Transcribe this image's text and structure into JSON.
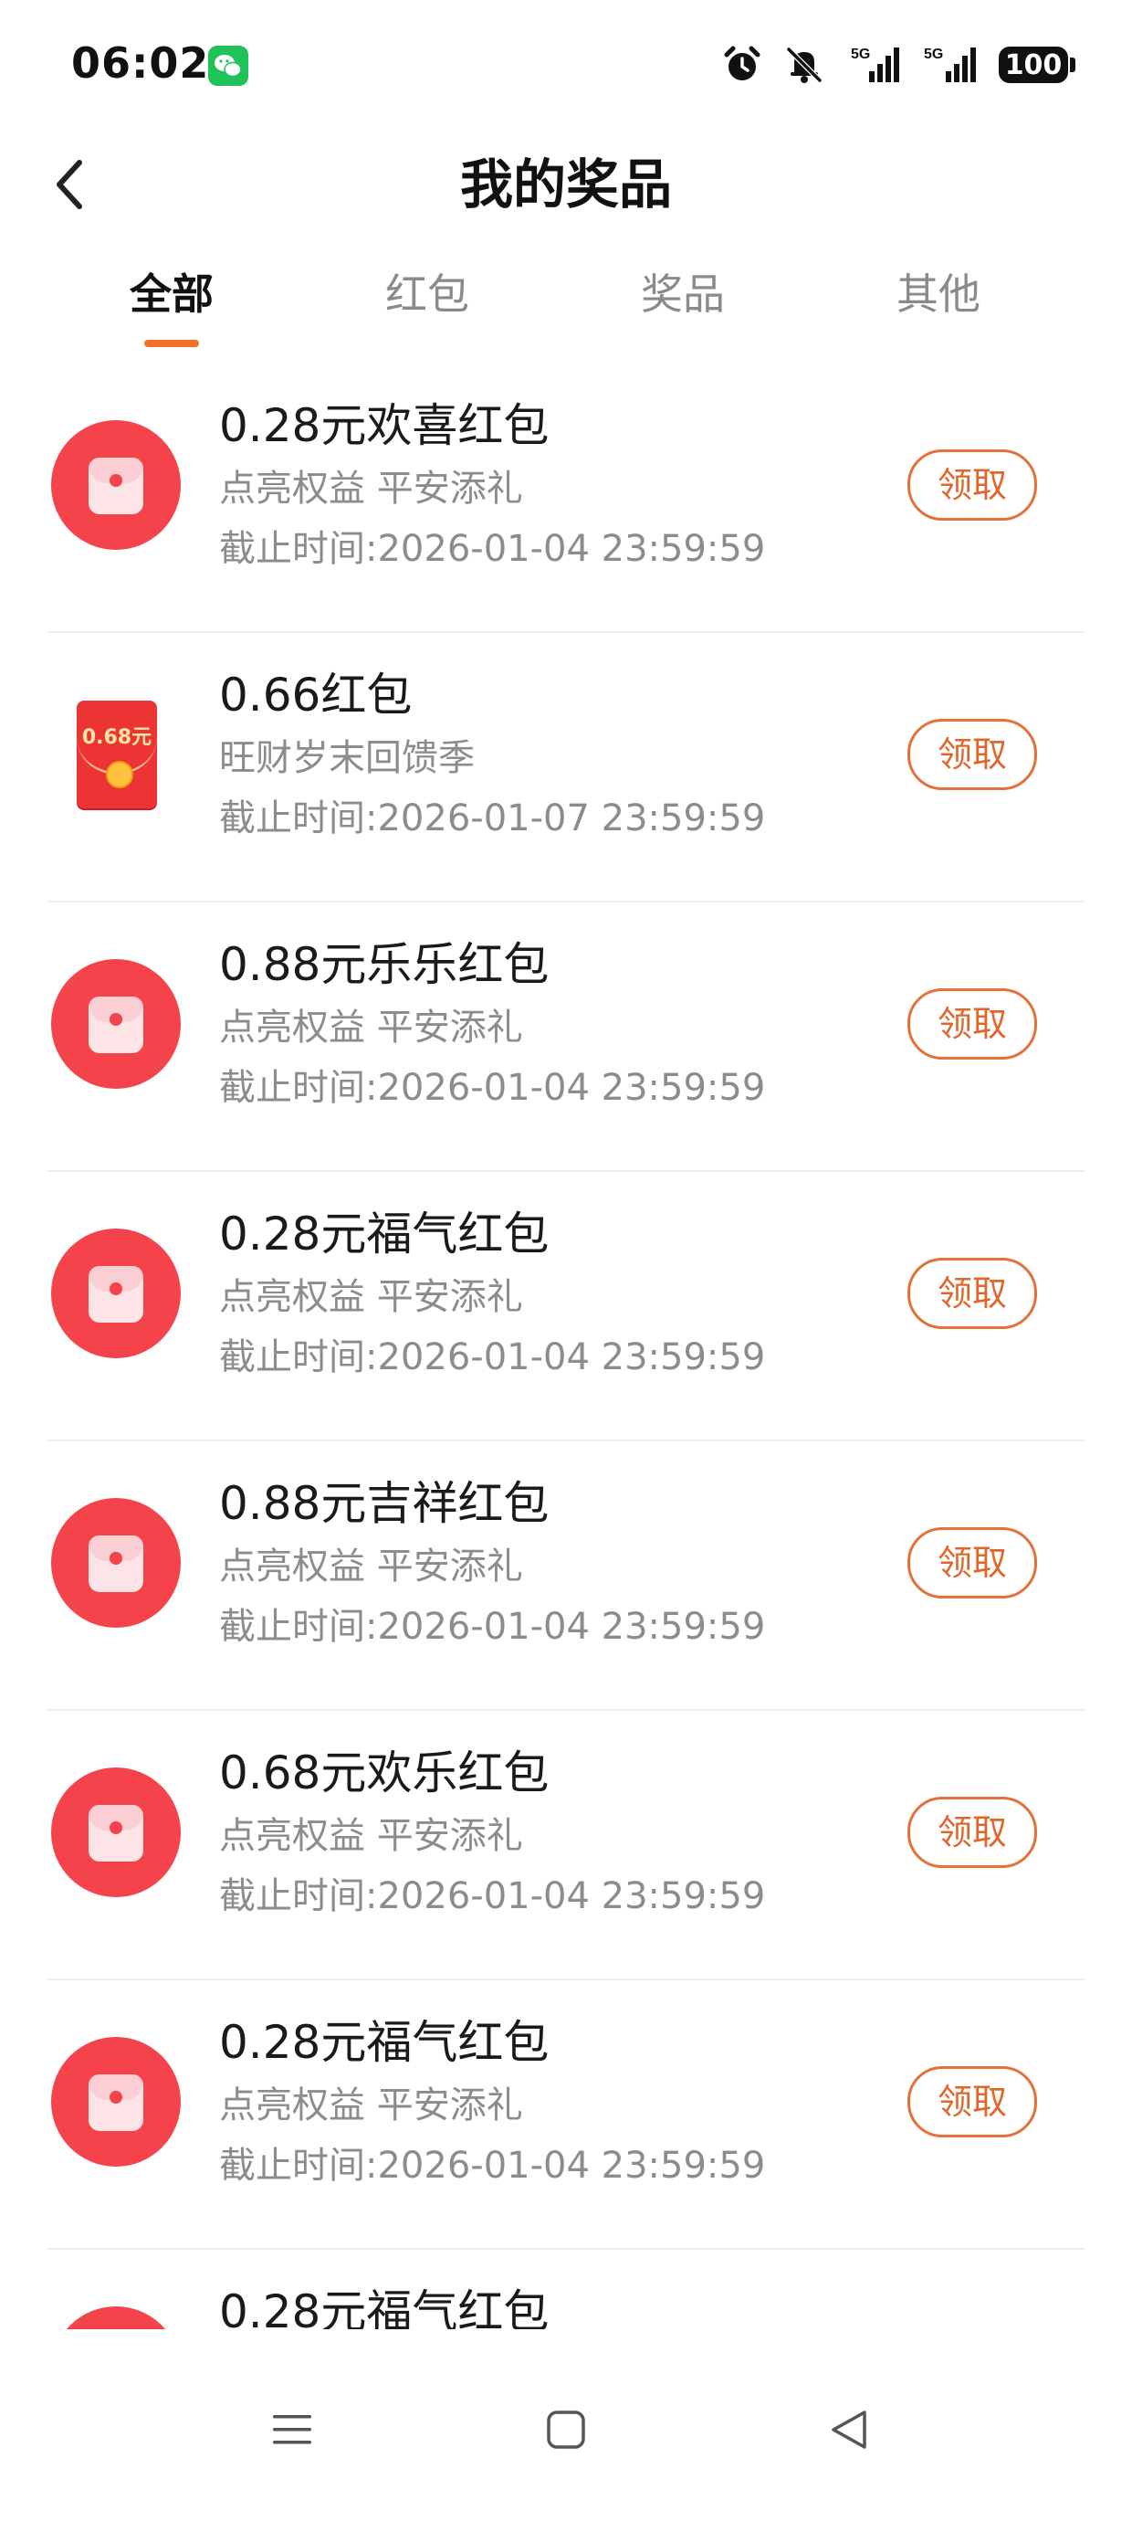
{
  "status_bar": {
    "time": "06:02",
    "battery": "100",
    "icons": [
      "wechat-icon",
      "alarm-icon",
      "mute-bell-icon",
      "signal-5g-icon",
      "signal-5g-icon",
      "battery-icon"
    ]
  },
  "header": {
    "title": "我的奖品",
    "back_icon": "chevron-left-icon"
  },
  "tabs": [
    {
      "label": "全部",
      "active": true
    },
    {
      "label": "红包",
      "active": false
    },
    {
      "label": "奖品",
      "active": false
    },
    {
      "label": "其他",
      "active": false
    }
  ],
  "items": [
    {
      "title": "0.28元欢喜红包",
      "subtitle": "点亮权益 平安添礼",
      "deadline": "截止时间:2026-01-04 23:59:59",
      "button": "领取",
      "icon": "red-envelope-circle-icon"
    },
    {
      "title": "0.66红包",
      "subtitle": "旺财岁末回馈季",
      "deadline": "截止时间:2026-01-07 23:59:59",
      "button": "领取",
      "icon": "red-envelope-image-icon",
      "icon_text": "0.68元"
    },
    {
      "title": "0.88元乐乐红包",
      "subtitle": "点亮权益 平安添礼",
      "deadline": "截止时间:2026-01-04 23:59:59",
      "button": "领取",
      "icon": "red-envelope-circle-icon"
    },
    {
      "title": "0.28元福气红包",
      "subtitle": "点亮权益 平安添礼",
      "deadline": "截止时间:2026-01-04 23:59:59",
      "button": "领取",
      "icon": "red-envelope-circle-icon"
    },
    {
      "title": "0.88元吉祥红包",
      "subtitle": "点亮权益 平安添礼",
      "deadline": "截止时间:2026-01-04 23:59:59",
      "button": "领取",
      "icon": "red-envelope-circle-icon"
    },
    {
      "title": "0.68元欢乐红包",
      "subtitle": "点亮权益 平安添礼",
      "deadline": "截止时间:2026-01-04 23:59:59",
      "button": "领取",
      "icon": "red-envelope-circle-icon"
    },
    {
      "title": "0.28元福气红包",
      "subtitle": "点亮权益 平安添礼",
      "deadline": "截止时间:2026-01-04 23:59:59",
      "button": "领取",
      "icon": "red-envelope-circle-icon"
    },
    {
      "title": "0.28元福气红包",
      "subtitle": "",
      "deadline": "",
      "button": "",
      "icon": "red-envelope-circle-icon"
    }
  ],
  "nav_bar": {
    "icons": [
      "menu-icon",
      "home-square-icon",
      "back-triangle-icon"
    ]
  },
  "colors": {
    "accent": "#f5712a",
    "button_border": "#e2713a",
    "envelope_red": "#f4434a"
  }
}
